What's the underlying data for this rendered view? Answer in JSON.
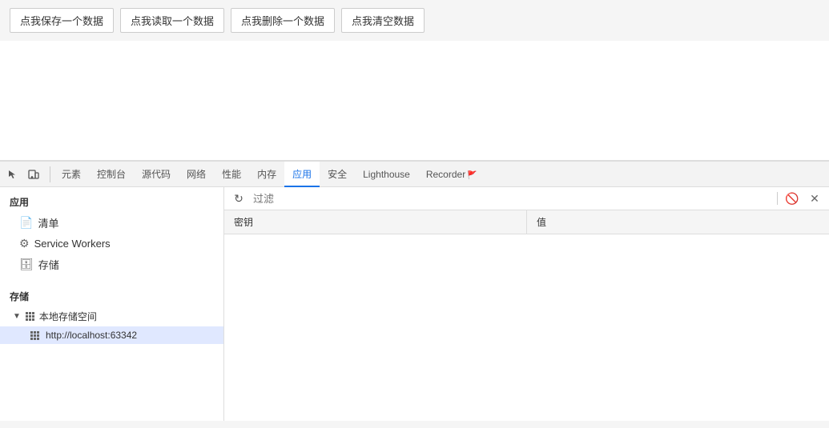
{
  "buttons": {
    "save": "点我保存一个数据",
    "read": "点我读取一个数据",
    "delete": "点我删除一个数据",
    "clear": "点我清空数据"
  },
  "tabs": [
    {
      "label": "元素",
      "id": "elements"
    },
    {
      "label": "控制台",
      "id": "console"
    },
    {
      "label": "源代码",
      "id": "sources"
    },
    {
      "label": "网络",
      "id": "network"
    },
    {
      "label": "性能",
      "id": "performance"
    },
    {
      "label": "内存",
      "id": "memory"
    },
    {
      "label": "应用",
      "id": "application",
      "active": true
    },
    {
      "label": "安全",
      "id": "security"
    },
    {
      "label": "Lighthouse",
      "id": "lighthouse"
    },
    {
      "label": "Recorder",
      "id": "recorder",
      "hasIcon": true
    }
  ],
  "sidebar": {
    "section1_title": "应用",
    "items": [
      {
        "label": "清单",
        "icon": "📄",
        "id": "manifest"
      },
      {
        "label": "Service Workers",
        "icon": "⚙",
        "id": "service-workers"
      },
      {
        "label": "存储",
        "icon": "🗄",
        "id": "storage"
      }
    ],
    "section2_title": "存储",
    "groups": [
      {
        "label": "本地存储空间",
        "icon": "grid",
        "expanded": true,
        "children": [
          {
            "label": "http://localhost:63342",
            "icon": "grid",
            "active": true
          }
        ]
      }
    ]
  },
  "filter": {
    "placeholder": "过滤",
    "value": ""
  },
  "table": {
    "columns": [
      "密钥",
      "值"
    ],
    "rows": []
  }
}
